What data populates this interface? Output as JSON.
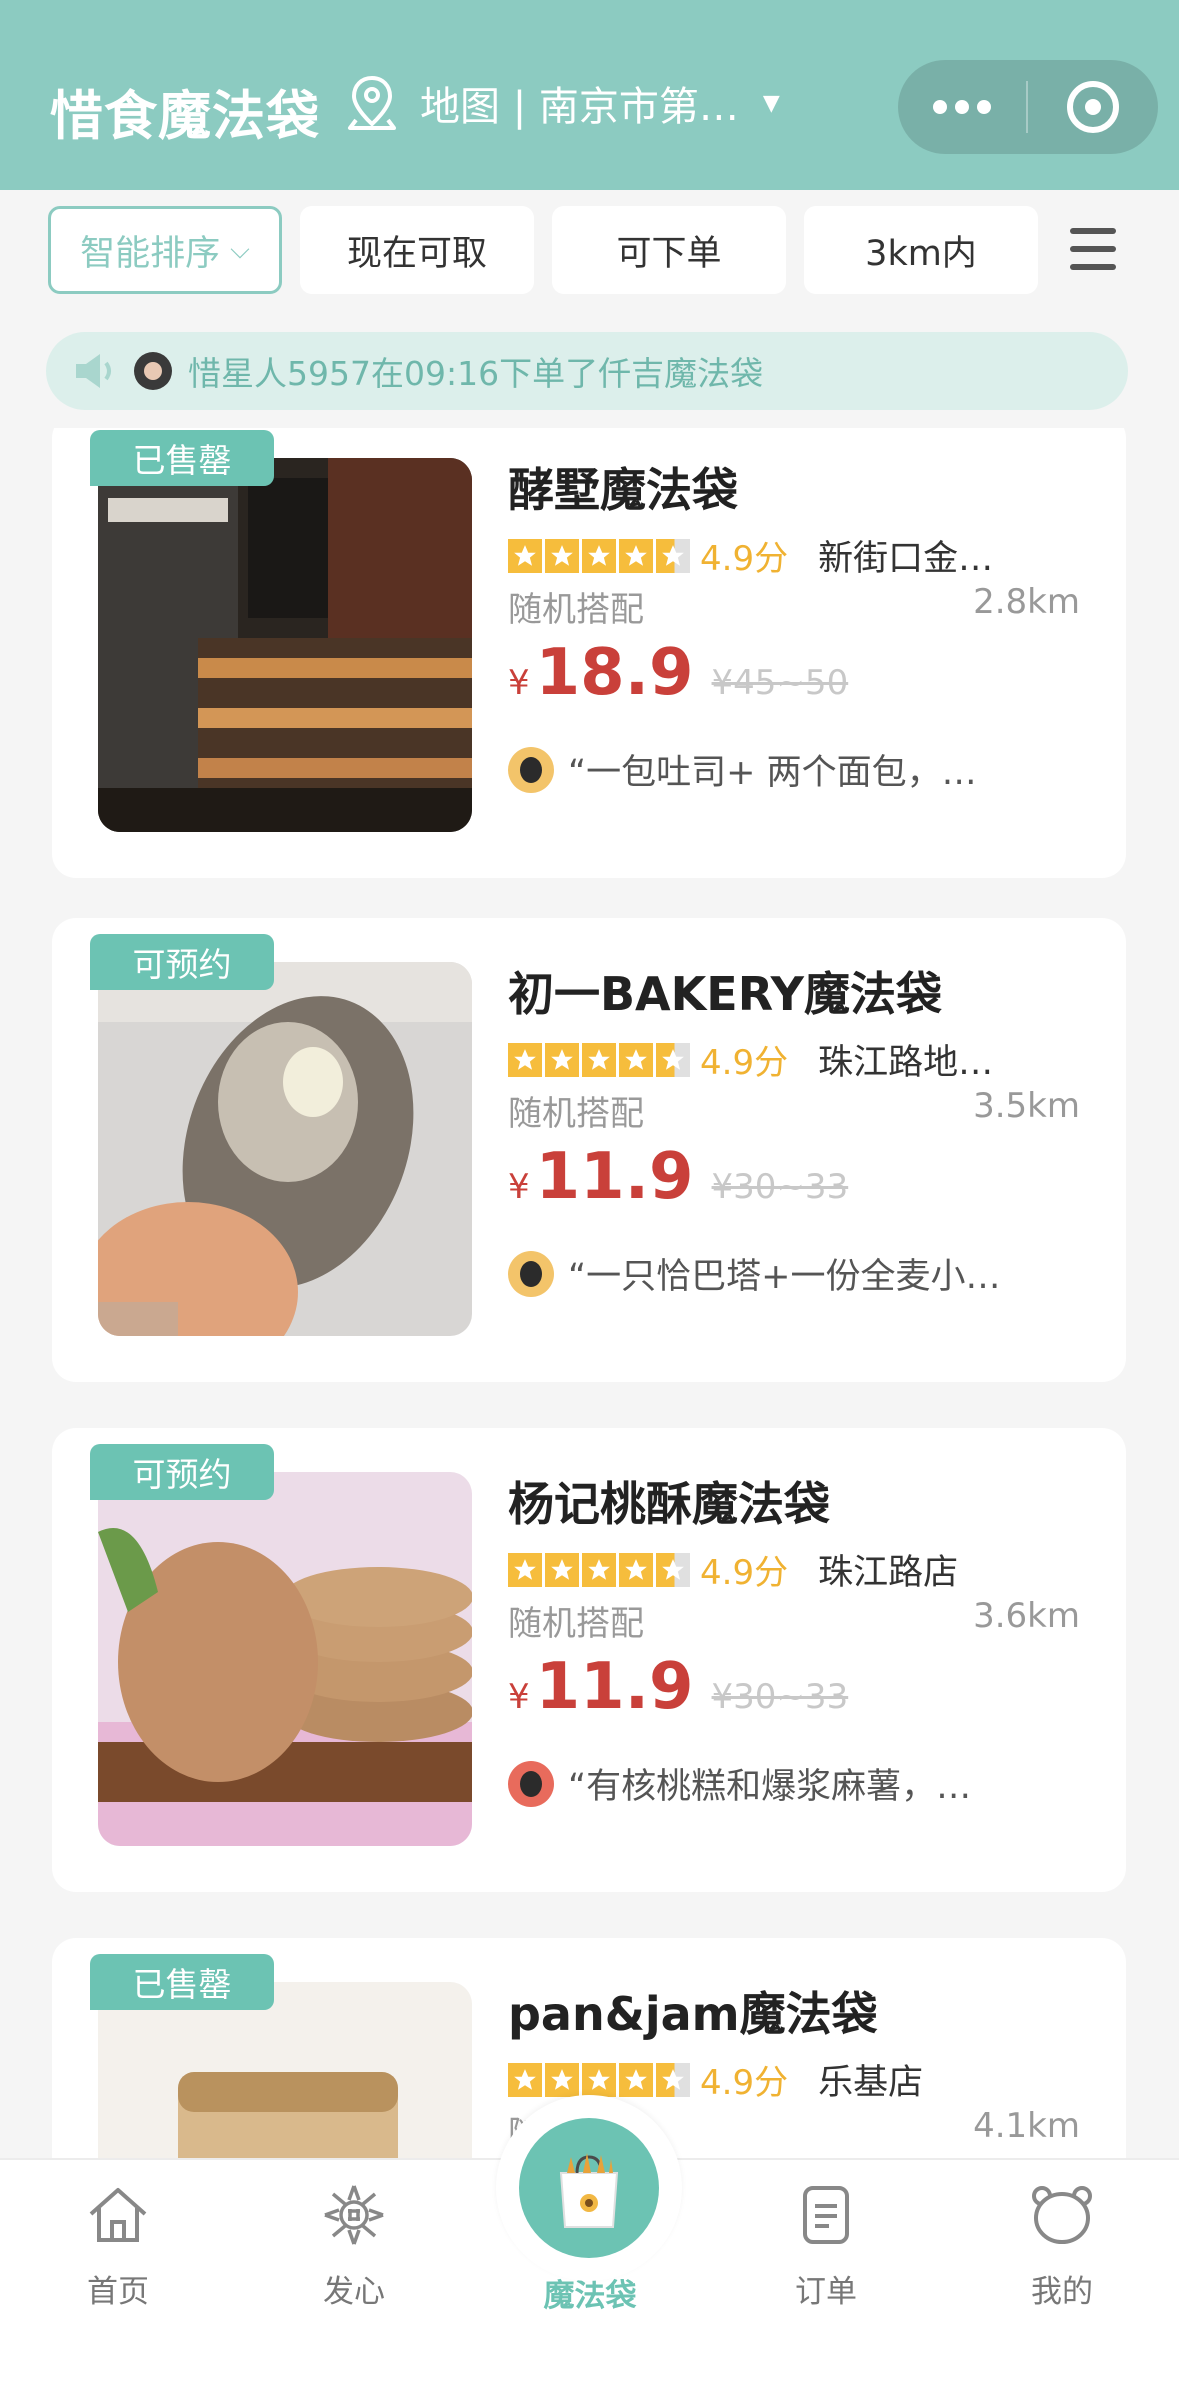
{
  "header": {
    "title": "惜食魔法袋",
    "location_text": "地图 | 南京市第…",
    "capsule_more_icon": "more-icon",
    "capsule_close_icon": "target-icon"
  },
  "filters": {
    "sort_label": "智能排序",
    "chips": [
      "现在可取",
      "可下单",
      "3km内"
    ],
    "menu_icon": "menu-icon"
  },
  "notice": {
    "text": "惜星人5957在09:16下单了仟吉魔法袋"
  },
  "cards": [
    {
      "badge": "已售罄",
      "name": "酵墅魔法袋",
      "score": "4.9分",
      "location": "新街口金…",
      "mix": "随机搭配",
      "distance": "2.8km",
      "currency": "¥",
      "price": "18.9",
      "original": "¥45~50",
      "review": "“一包吐司+ 两个面包，…"
    },
    {
      "badge": "可预约",
      "name": "初一BAKERY魔法袋",
      "score": "4.9分",
      "location": "珠江路地…",
      "mix": "随机搭配",
      "distance": "3.5km",
      "currency": "¥",
      "price": "11.9",
      "original": "¥30~33",
      "review": "“一只恰巴塔+一份全麦小…"
    },
    {
      "badge": "可预约",
      "name": "杨记桃酥魔法袋",
      "score": "4.9分",
      "location": "珠江路店",
      "mix": "随机搭配",
      "distance": "3.6km",
      "currency": "¥",
      "price": "11.9",
      "original": "¥30~33",
      "review": "“有核桃糕和爆浆麻薯，…"
    },
    {
      "badge": "已售罄",
      "name": "pan&jam魔法袋",
      "score": "4.9分",
      "location": "乐基店",
      "mix": "随机搭配",
      "distance": "4.1km",
      "currency": "¥",
      "price": "",
      "original": "",
      "review": ""
    }
  ],
  "tabbar": {
    "tabs": [
      {
        "label": "首页",
        "icon": "home-icon"
      },
      {
        "label": "发心",
        "icon": "sunflower-icon"
      },
      {
        "label": "魔法袋",
        "icon": "magic-bag-icon"
      },
      {
        "label": "订单",
        "icon": "order-icon"
      },
      {
        "label": "我的",
        "icon": "profile-icon"
      }
    ],
    "active_index": 2
  },
  "colors": {
    "brand": "#8ccbc1",
    "accent": "#6cc3b3",
    "price": "#c9403a",
    "star": "#f6bd3c"
  }
}
